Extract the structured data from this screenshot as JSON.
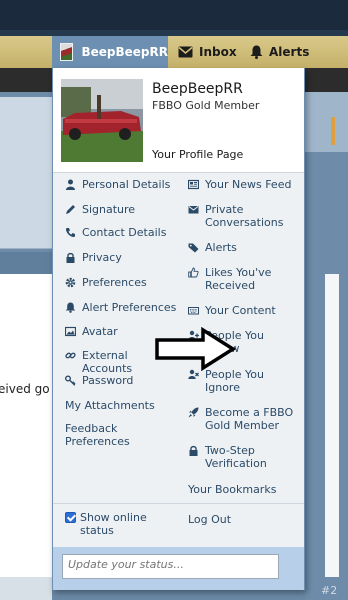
{
  "nav": {
    "user_tab": "BeepBeepRR",
    "inbox_tab": "Inbox",
    "alerts_tab": "Alerts"
  },
  "background": {
    "partial_text": "eived go",
    "post_number": "#2"
  },
  "menu": {
    "username": "BeepBeepRR",
    "rank": "FBBO Gold Member",
    "profile_link": "Your Profile Page",
    "left_items": [
      {
        "label": "Personal Details",
        "icon": "person-icon"
      },
      {
        "label": "Signature",
        "icon": "pen-icon"
      },
      {
        "label": "Contact Details",
        "icon": "phone-icon"
      },
      {
        "label": "Privacy",
        "icon": "lock-icon"
      },
      {
        "label": "Preferences",
        "icon": "gear-icon"
      },
      {
        "label": "Alert Preferences",
        "icon": "bell-icon"
      },
      {
        "label": "Avatar",
        "icon": "image-icon"
      },
      {
        "label": "External Accounts",
        "icon": "link-icon"
      },
      {
        "label": "Password",
        "icon": "key-icon"
      },
      {
        "label": "My Attachments",
        "icon": ""
      },
      {
        "label": "Feedback Preferences",
        "icon": ""
      }
    ],
    "right_items": [
      {
        "label": "Your News Feed",
        "icon": "news-icon"
      },
      {
        "label": "Private Conversations",
        "icon": "envelope-icon"
      },
      {
        "label": "Alerts",
        "icon": "tag-icon"
      },
      {
        "label": "Likes You've Received",
        "icon": "thumbs-up-icon"
      },
      {
        "label": "Your Content",
        "icon": "keyboard-icon"
      },
      {
        "label": "People You Follow",
        "icon": "user-plus-icon"
      },
      {
        "label": "People You Ignore",
        "icon": "user-x-icon"
      },
      {
        "label": "Become a FBBO Gold Member",
        "icon": "rocket-icon"
      },
      {
        "label": "Two-Step Verification",
        "icon": "lock-icon"
      },
      {
        "label": "Your Bookmarks",
        "icon": ""
      }
    ],
    "show_online_label": "Show online status",
    "show_online_checked": true,
    "logout_label": "Log Out",
    "status_placeholder": "Update your status..."
  },
  "colors": {
    "link": "#2b4a67",
    "active_tab": "#6d8fb1",
    "nav_bar": "#d2c07c",
    "status_area": "#b7cfe8"
  }
}
